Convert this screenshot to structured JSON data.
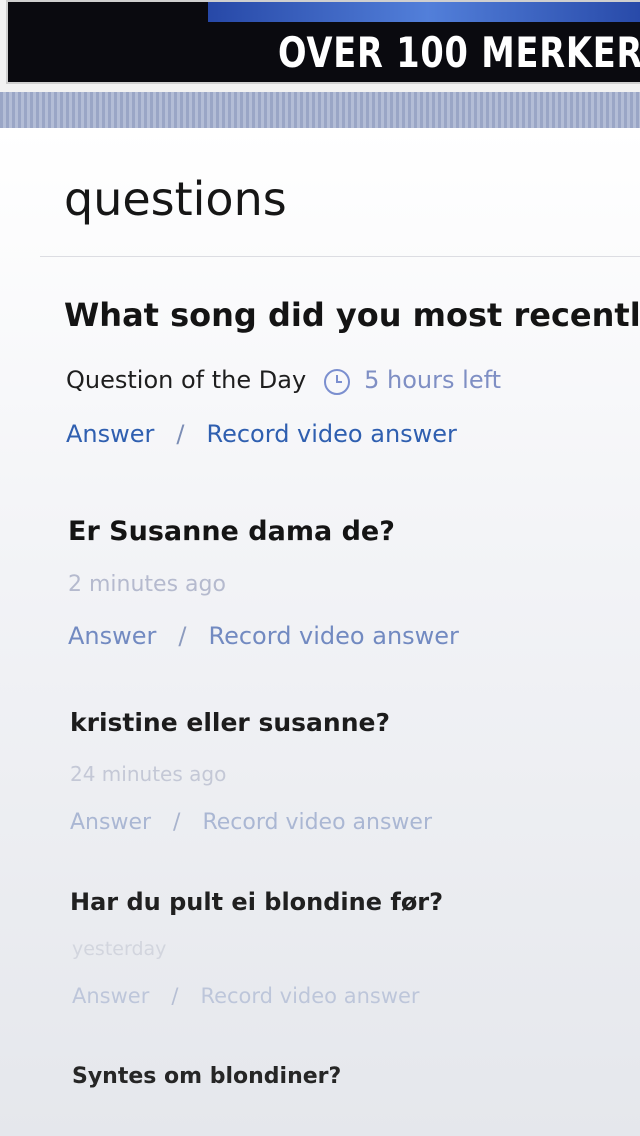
{
  "banner": {
    "text": "OVER 100 MERKER"
  },
  "page": {
    "title": "questions"
  },
  "questions": [
    {
      "title": "What song did you most recently",
      "category": "Question of the Day",
      "time": "5 hours left",
      "answer_label": "Answer",
      "separator": "/",
      "record_label": "Record video answer"
    },
    {
      "title": "Er Susanne dama de?",
      "time": "2 minutes ago",
      "answer_label": "Answer",
      "separator": "/",
      "record_label": "Record video answer"
    },
    {
      "title": "kristine eller susanne?",
      "time": "24 minutes ago",
      "answer_label": "Answer",
      "separator": "/",
      "record_label": "Record video answer"
    },
    {
      "title": "Har du pult ei blondine før?",
      "time": "yesterday",
      "answer_label": "Answer",
      "separator": "/",
      "record_label": "Record video answer"
    },
    {
      "title": "Syntes om blondiner?"
    }
  ]
}
